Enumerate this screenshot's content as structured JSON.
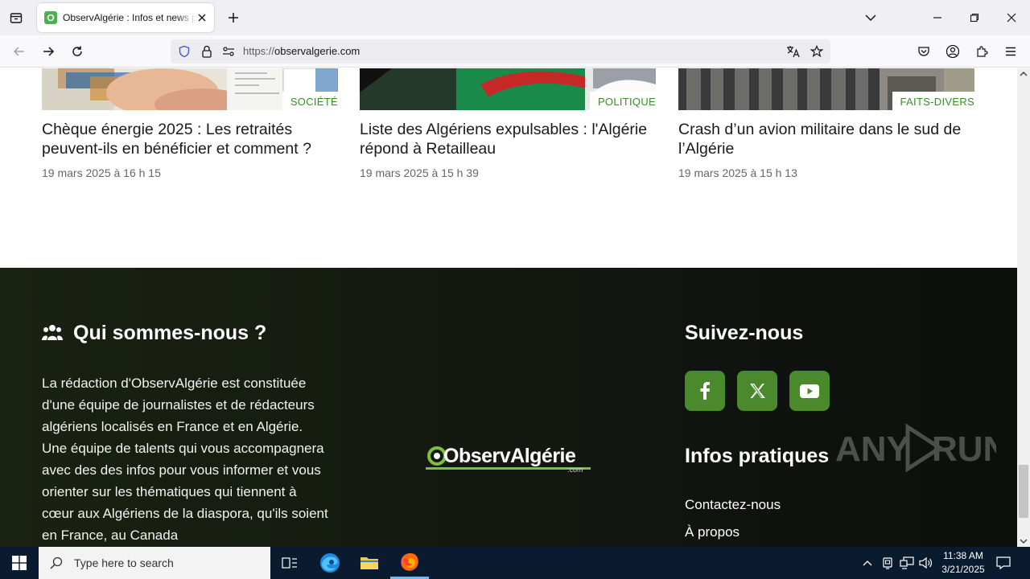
{
  "browser": {
    "tab_title": "ObservAlgérie : Infos et news pour la diaspora",
    "url_protocol": "https://",
    "url_domain": "observalgerie.com"
  },
  "articles": [
    {
      "category": "SOCIÉTÉ",
      "title": "Chèque énergie 2025 : Les retraités peuvent-ils en bénéficier et comment ?",
      "date": "19 mars 2025 à 16 h 15"
    },
    {
      "category": "POLITIQUE",
      "title": "Liste des Algériens expulsables : l'Algérie répond à Retailleau",
      "date": "19 mars 2025 à 15 h 39"
    },
    {
      "category": "FAITS-DIVERS",
      "title": "Crash d’un avion militaire dans le sud de l’Algérie",
      "date": "19 mars 2025 à 15 h 13"
    }
  ],
  "footer": {
    "about_heading": "Qui sommes-nous ?",
    "about_text": "La rédaction d'ObservAlgérie est constituée d'une équipe de journalistes et de rédacteurs algériens localisés en France et en Algérie. Une équipe de talents qui vous accompagnera avec des des infos pour vous informer et vous orienter sur les thématiques qui tiennent à cœur aux Algériens de la diaspora, qu'ils soient en France, au Canada",
    "logo_text": "ObservAlgérie",
    "logo_suffix": ".com",
    "follow_heading": "Suivez-nous",
    "social": [
      "facebook-icon",
      "x-twitter-icon",
      "youtube-icon"
    ],
    "info_heading": "Infos pratiques",
    "links": [
      "Contactez-nous",
      "À propos"
    ]
  },
  "watermark": "ANY RUN",
  "taskbar": {
    "search_placeholder": "Type here to search",
    "time": "11:38 AM",
    "date": "3/21/2025"
  },
  "colors": {
    "accent_green": "#4a8a2c",
    "category_green": "#3b8a2a",
    "footer_bg": "#141a10"
  }
}
